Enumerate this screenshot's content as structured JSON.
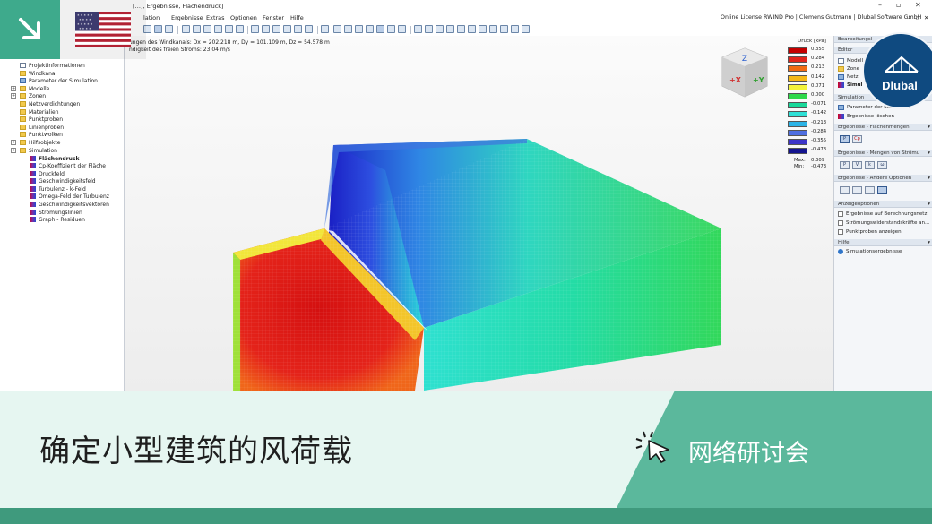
{
  "window": {
    "title": "[…], Ergebnisse, Flächendruck]",
    "license": "Online License RWIND Pro | Clemens Gutmann | Dlubal Software GmbH",
    "btn_min": "–",
    "btn_max": "▫",
    "btn_close": "✕",
    "btn_mdi_min": "–",
    "btn_mdi_restore": "▫",
    "btn_mdi_close": "✕"
  },
  "menu": [
    "lation",
    "Ergebnisse",
    "Extras",
    "Optionen",
    "Fenster",
    "Hilfe"
  ],
  "tree": {
    "items": [
      {
        "label": "Projektinformationen",
        "icon": "doc"
      },
      {
        "label": "Windkanal",
        "icon": "folder"
      },
      {
        "label": "Parameter der Simulation",
        "icon": "wind"
      },
      {
        "label": "Modelle",
        "icon": "folder"
      },
      {
        "label": "Zonen",
        "icon": "folder"
      },
      {
        "label": "Netzverdichtungen",
        "icon": "folder"
      },
      {
        "label": "Materialien",
        "icon": "folder"
      },
      {
        "label": "Punktproben",
        "icon": "folder"
      },
      {
        "label": "Linienproben",
        "icon": "folder"
      },
      {
        "label": "Punktwolken",
        "icon": "folder"
      },
      {
        "label": "Hilfsobjekte",
        "icon": "folder"
      },
      {
        "label": "Simulation",
        "icon": "folder"
      },
      {
        "label": "Flächendruck",
        "icon": "grad"
      },
      {
        "label": "Cp-Koeffizient der Fläche",
        "icon": "grad"
      },
      {
        "label": "Druckfeld",
        "icon": "grad"
      },
      {
        "label": "Geschwindigkeitsfeld",
        "icon": "grad"
      },
      {
        "label": "Turbulenz - k-Feld",
        "icon": "grad"
      },
      {
        "label": "Omega-Feld der Turbulenz",
        "icon": "grad"
      },
      {
        "label": "Geschwindigkeitsvektoren",
        "icon": "grad"
      },
      {
        "label": "Strömungslinien",
        "icon": "grad"
      },
      {
        "label": "Graph - Residuen",
        "icon": "grad"
      }
    ]
  },
  "viewport": {
    "info_line1": "ungen des Windkanals: Dx = 202.218 m, Dy = 101.109 m, Dz = 54.578 m",
    "info_line2": "ndigkeit des freien Stroms: 23.04 m/s",
    "cube_x": "+X",
    "cube_y": "+Y",
    "cube_z": "Z"
  },
  "legend": {
    "title": "Druck [kPa]",
    "values": [
      "0.355",
      "0.284",
      "0.213",
      "0.142",
      "0.071",
      "0.000",
      "-0.071",
      "-0.142",
      "-0.213",
      "-0.284",
      "-0.355",
      "-0.473"
    ],
    "colors": [
      "#c40000",
      "#e0241c",
      "#f06a12",
      "#f5b817",
      "#f2f23a",
      "#2fd94a",
      "#18d99a",
      "#2ee0d6",
      "#2bb3e6",
      "#4f6fe0",
      "#3c34c8",
      "#14148f"
    ],
    "max_label": "Max:",
    "max_value": "0.309",
    "min_label": "Min:",
    "min_value": "-0.473"
  },
  "rpanel": {
    "title": "Bearbeitungsl",
    "sections": {
      "editor": "Editor",
      "simulation": "Simulation",
      "results_surface": "Ergebnisse - Flächenmengen",
      "results_flow": "Ergebnisse - Mengen von Strömu",
      "results_other": "Ergebnisse - Andere Optionen",
      "display": "Anzeigeoptionen",
      "help": "Hilfe"
    },
    "editor_items": [
      "Modell",
      "Zone",
      "Netz",
      "Simul"
    ],
    "simulation_items": [
      "Parameter der Simulation",
      "Ergebnisse löschen"
    ],
    "surface_buttons": [
      "P",
      "Cp"
    ],
    "flow_buttons": [
      "P",
      "V",
      "k",
      "ω"
    ],
    "display_items": [
      "Ergebnisse auf Berechnungsnetz",
      "Strömungswiderstandskräfte an…",
      "Punktproben anzeigen"
    ],
    "help_item": "Simulationsergebnisse"
  },
  "overlay": {
    "logo_text": "Dlubal",
    "banner_title": "确定小型建筑的风荷载",
    "banner_sub": "网络研讨会"
  },
  "colors": {
    "accent_green": "#3eaa8c",
    "banner_green": "#5bb89c",
    "banner_light": "#e6f6f1",
    "dlubal_blue": "#0f4a80"
  }
}
